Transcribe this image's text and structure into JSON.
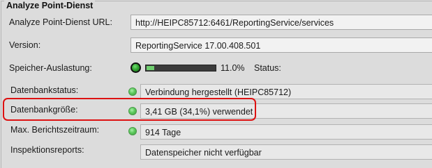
{
  "panel": {
    "title": "Analyze Point-Dienst"
  },
  "rows": {
    "url": {
      "label": "Analyze Point-Dienst URL:",
      "value": "http://HEIPC85712:6461/ReportingService/services"
    },
    "version": {
      "label": "Version:",
      "value": "ReportingService 17.00.408.501"
    },
    "memory": {
      "label": "Speicher-Auslastung:",
      "percent_text": "11.0%",
      "progress": 0.11,
      "status_label": "Status:"
    },
    "db_status": {
      "label": "Datenbankstatus:",
      "value": "Verbindung hergestellt (HEIPC85712)"
    },
    "db_size": {
      "label": "Datenbankgröße:",
      "value": "3,41 GB  (34,1%) verwendet"
    },
    "max_period": {
      "label": "Max. Berichtszeitraum:",
      "value": "914 Tage"
    },
    "inspection": {
      "label": "Inspektionsreports:",
      "value": "Datenspeicher nicht verfügbar"
    }
  },
  "colors": {
    "highlight": "#dd1111",
    "status_ok": "#5cc95c"
  },
  "icons": {
    "status": "status-ok-icon",
    "memory": "memory-status-icon"
  }
}
